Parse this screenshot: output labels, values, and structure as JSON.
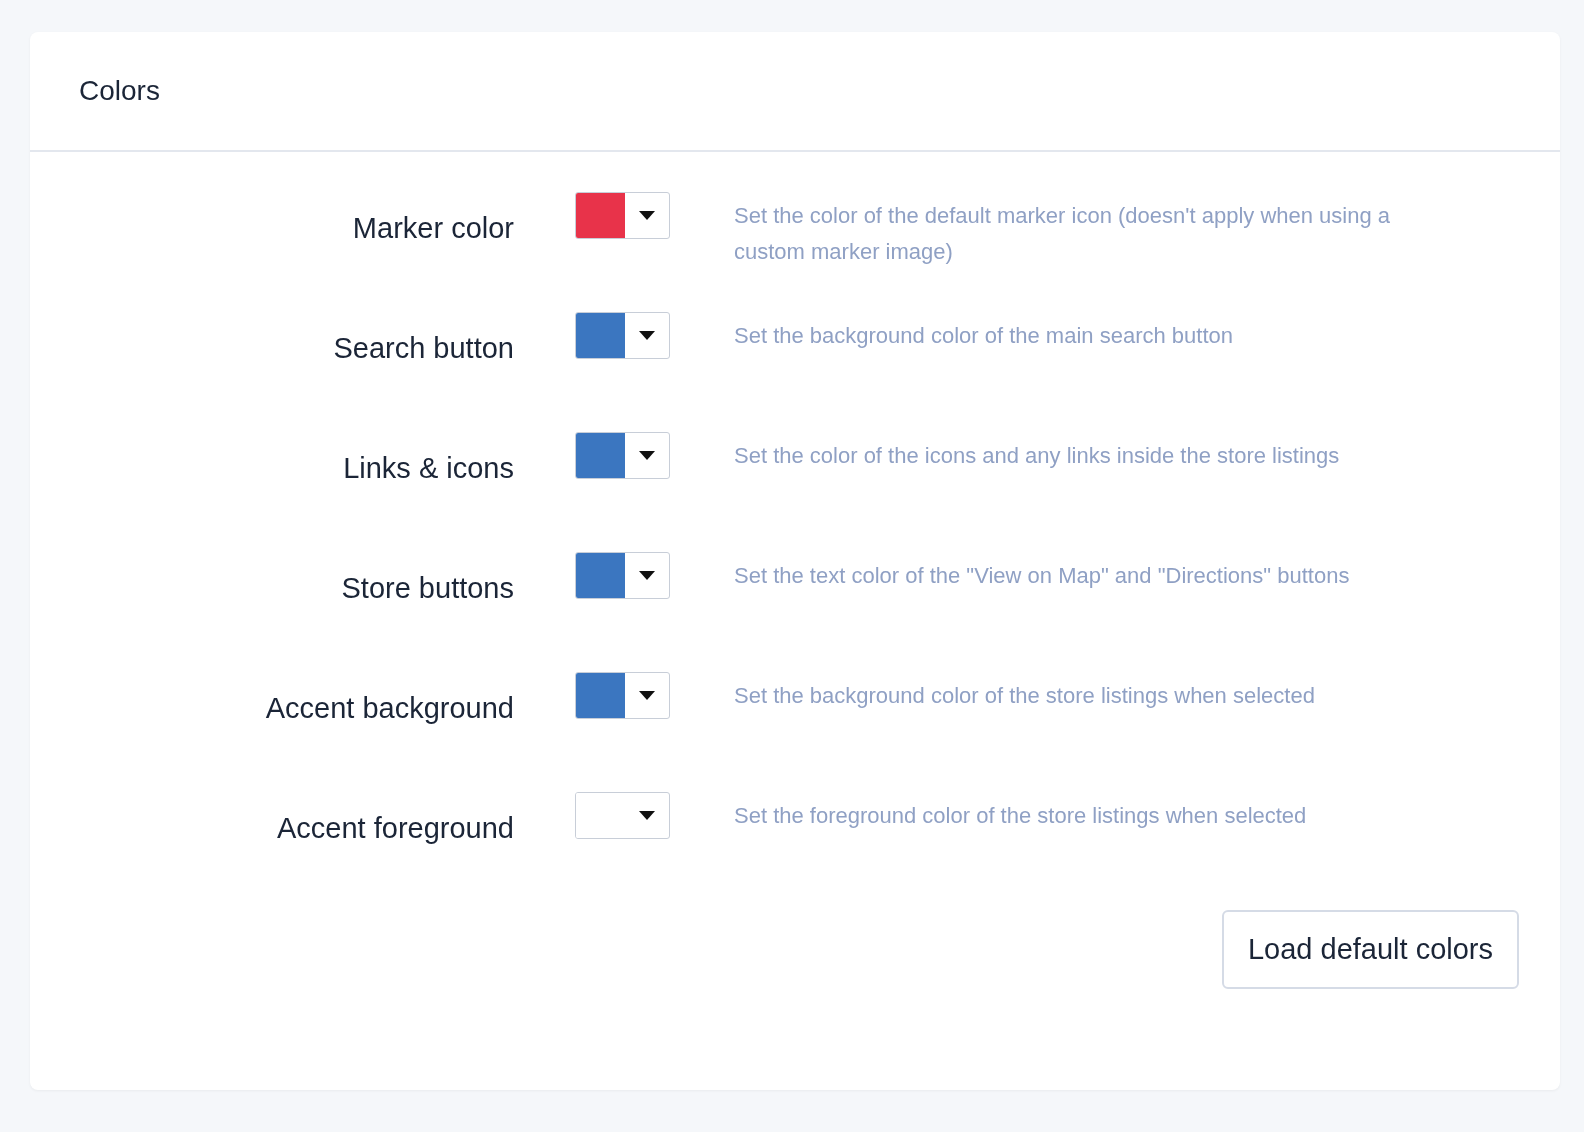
{
  "panel": {
    "title": "Colors"
  },
  "rows": [
    {
      "label": "Marker color",
      "color": "#e8334a",
      "description": "Set the color of the default marker icon (doesn't apply when using a custom marker image)"
    },
    {
      "label": "Search button",
      "color": "#3b76c0",
      "description": "Set the background color of the main search button"
    },
    {
      "label": "Links & icons",
      "color": "#3b76c0",
      "description": "Set the color of the icons and any links inside the store listings"
    },
    {
      "label": "Store buttons",
      "color": "#3b76c0",
      "description": "Set the text color of the \"View on Map\" and \"Directions\" buttons"
    },
    {
      "label": "Accent background",
      "color": "#3b76c0",
      "description": "Set the background color of the store listings when selected"
    },
    {
      "label": "Accent foreground",
      "color": "#ffffff",
      "description": "Set the foreground color of the store listings when selected"
    }
  ],
  "button": {
    "label": "Load default colors"
  }
}
